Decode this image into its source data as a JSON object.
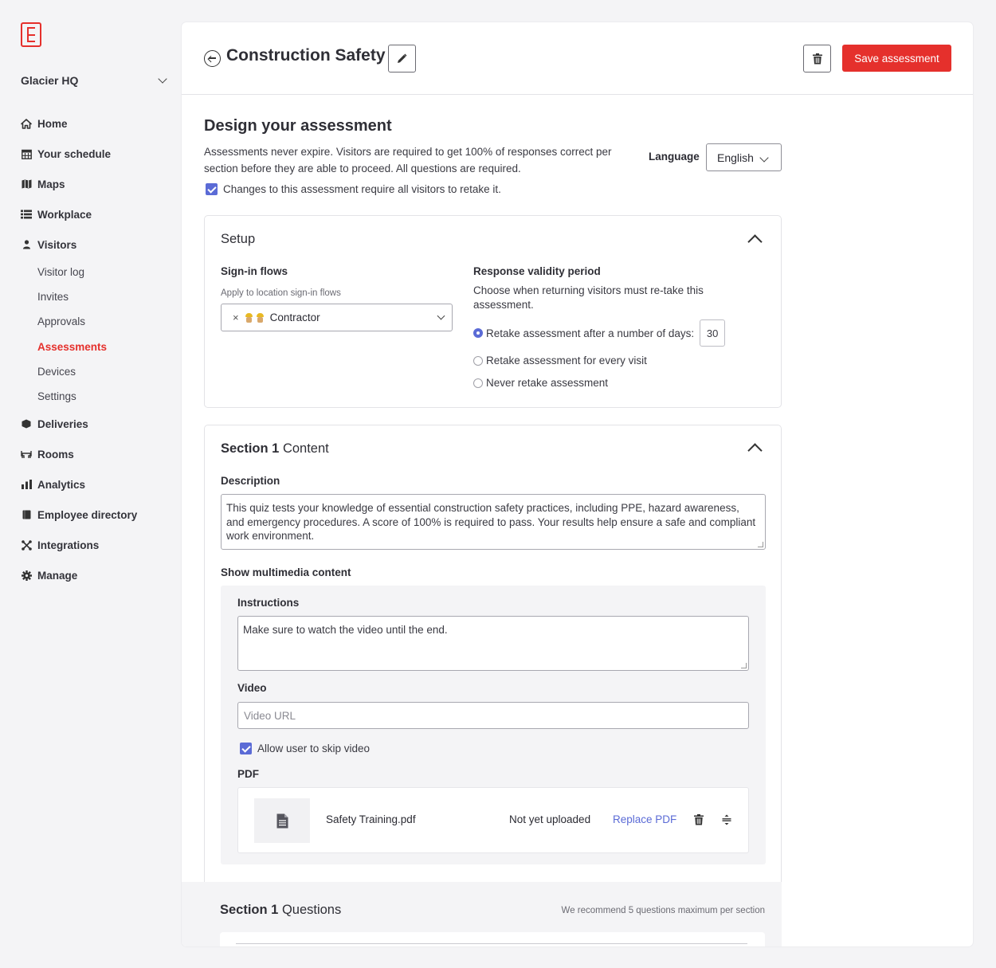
{
  "sidebar": {
    "location": "Glacier HQ",
    "nav": [
      {
        "label": "Home",
        "icon": "home-icon"
      },
      {
        "label": "Your schedule",
        "icon": "calendar-icon"
      },
      {
        "label": "Maps",
        "icon": "map-icon"
      },
      {
        "label": "Workplace",
        "icon": "list-icon"
      },
      {
        "label": "Visitors",
        "icon": "person-icon"
      }
    ],
    "visitors_sub": [
      "Visitor log",
      "Invites",
      "Approvals",
      "Assessments",
      "Devices",
      "Settings"
    ],
    "nav_after": [
      {
        "label": "Deliveries",
        "icon": "package-icon"
      },
      {
        "label": "Rooms",
        "icon": "room-icon"
      },
      {
        "label": "Analytics",
        "icon": "bar-chart-icon"
      },
      {
        "label": "Employee directory",
        "icon": "book-icon"
      },
      {
        "label": "Integrations",
        "icon": "integrations-icon"
      },
      {
        "label": "Manage",
        "icon": "gear-icon"
      }
    ]
  },
  "header": {
    "title": "Construction Safety",
    "save_label": "Save assessment"
  },
  "design": {
    "heading": "Design your assessment",
    "description": "Assessments never expire. Visitors are required to get 100% of responses correct per section before they are able to proceed. All questions are required.",
    "language_label": "Language",
    "language_value": "English",
    "retake_check_label": "Changes to this assessment require all visitors to retake it."
  },
  "setup": {
    "title": "Setup",
    "signin_label": "Sign-in flows",
    "signin_help": "Apply to location sign-in flows",
    "signin_chip": "Contractor",
    "chip_remove": "×",
    "validity_label": "Response validity period",
    "validity_help": "Choose when returning visitors must re-take this assessment.",
    "options": [
      "Retake assessment after a number of days:",
      "Retake assessment for every visit",
      "Never retake assessment"
    ],
    "days_value": "30"
  },
  "section_content": {
    "title_bold": "Section 1",
    "title_rest": " Content",
    "description_label": "Description",
    "description_value": "This quiz tests your knowledge of essential construction safety practices, including PPE, hazard awareness, and emergency procedures. A score of 100% is required to pass. Your results help ensure a safe and compliant work environment.",
    "multimedia_label": "Show multimedia content",
    "instructions_label": "Instructions",
    "instructions_value": "Make sure to watch the video until the end.",
    "video_label": "Video",
    "video_placeholder": "Video URL",
    "skip_label": "Allow user to skip video",
    "pdf_label": "PDF",
    "pdf_name": "Safety Training.pdf",
    "pdf_status": "Not yet uploaded",
    "pdf_replace": "Replace PDF"
  },
  "section_questions": {
    "title_bold": "Section 1",
    "title_rest": " Questions",
    "hint": "We recommend 5 questions maximum per section"
  },
  "colors": {
    "accent": "#e5302c",
    "primary": "#5b6bd6"
  }
}
